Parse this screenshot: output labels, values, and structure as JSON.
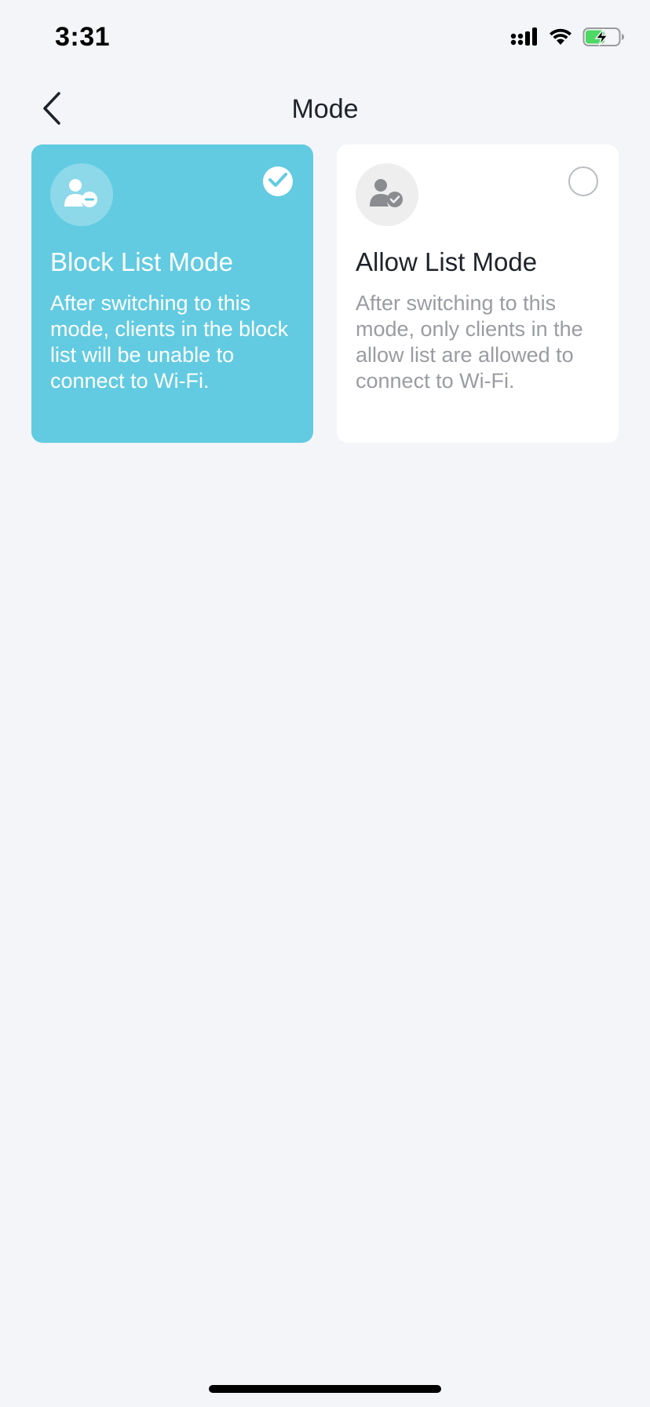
{
  "status_bar": {
    "time": "3:31",
    "icons": [
      "cellular-signal-icon",
      "wifi-icon",
      "battery-charging-icon"
    ],
    "battery_color": "#4cd964"
  },
  "nav": {
    "title": "Mode",
    "back_icon": "chevron-left-icon"
  },
  "modes": [
    {
      "title": "Block List Mode",
      "description": "After switching to this mode, clients in the block list will be unable to connect to Wi-Fi.",
      "icon": "user-minus-icon",
      "selected": true
    },
    {
      "title": "Allow List Mode",
      "description": "After switching to this mode, only clients in the allow list are allowed to connect to Wi-Fi.",
      "icon": "user-check-icon",
      "selected": false
    }
  ],
  "colors": {
    "accent": "#62cbe1",
    "background": "#f3f5f9",
    "card_unselected": "#ffffff",
    "muted_text": "#9a9ca1"
  }
}
